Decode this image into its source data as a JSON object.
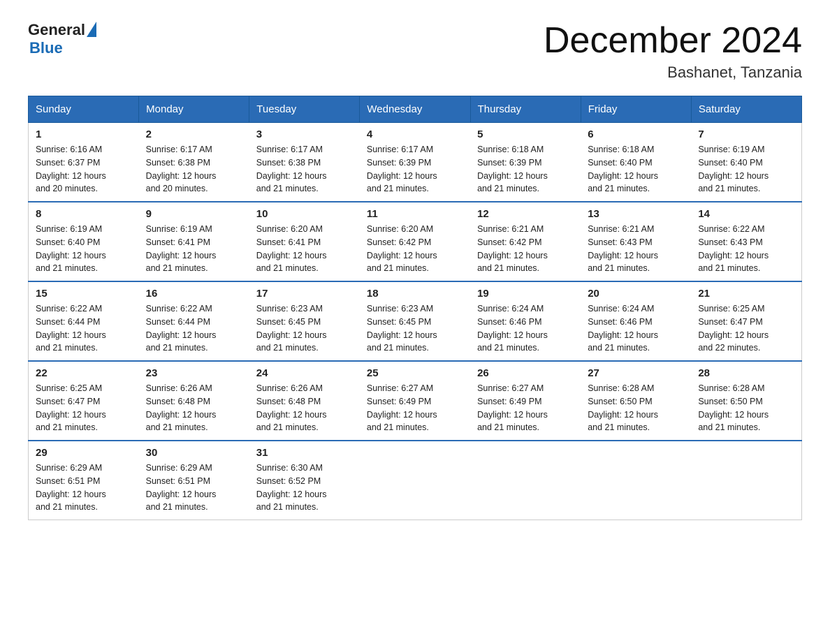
{
  "header": {
    "logo_general": "General",
    "logo_blue": "Blue",
    "month": "December 2024",
    "location": "Bashanet, Tanzania"
  },
  "weekdays": [
    "Sunday",
    "Monday",
    "Tuesday",
    "Wednesday",
    "Thursday",
    "Friday",
    "Saturday"
  ],
  "weeks": [
    [
      {
        "day": "1",
        "sunrise": "6:16 AM",
        "sunset": "6:37 PM",
        "daylight": "12 hours and 20 minutes."
      },
      {
        "day": "2",
        "sunrise": "6:17 AM",
        "sunset": "6:38 PM",
        "daylight": "12 hours and 20 minutes."
      },
      {
        "day": "3",
        "sunrise": "6:17 AM",
        "sunset": "6:38 PM",
        "daylight": "12 hours and 21 minutes."
      },
      {
        "day": "4",
        "sunrise": "6:17 AM",
        "sunset": "6:39 PM",
        "daylight": "12 hours and 21 minutes."
      },
      {
        "day": "5",
        "sunrise": "6:18 AM",
        "sunset": "6:39 PM",
        "daylight": "12 hours and 21 minutes."
      },
      {
        "day": "6",
        "sunrise": "6:18 AM",
        "sunset": "6:40 PM",
        "daylight": "12 hours and 21 minutes."
      },
      {
        "day": "7",
        "sunrise": "6:19 AM",
        "sunset": "6:40 PM",
        "daylight": "12 hours and 21 minutes."
      }
    ],
    [
      {
        "day": "8",
        "sunrise": "6:19 AM",
        "sunset": "6:40 PM",
        "daylight": "12 hours and 21 minutes."
      },
      {
        "day": "9",
        "sunrise": "6:19 AM",
        "sunset": "6:41 PM",
        "daylight": "12 hours and 21 minutes."
      },
      {
        "day": "10",
        "sunrise": "6:20 AM",
        "sunset": "6:41 PM",
        "daylight": "12 hours and 21 minutes."
      },
      {
        "day": "11",
        "sunrise": "6:20 AM",
        "sunset": "6:42 PM",
        "daylight": "12 hours and 21 minutes."
      },
      {
        "day": "12",
        "sunrise": "6:21 AM",
        "sunset": "6:42 PM",
        "daylight": "12 hours and 21 minutes."
      },
      {
        "day": "13",
        "sunrise": "6:21 AM",
        "sunset": "6:43 PM",
        "daylight": "12 hours and 21 minutes."
      },
      {
        "day": "14",
        "sunrise": "6:22 AM",
        "sunset": "6:43 PM",
        "daylight": "12 hours and 21 minutes."
      }
    ],
    [
      {
        "day": "15",
        "sunrise": "6:22 AM",
        "sunset": "6:44 PM",
        "daylight": "12 hours and 21 minutes."
      },
      {
        "day": "16",
        "sunrise": "6:22 AM",
        "sunset": "6:44 PM",
        "daylight": "12 hours and 21 minutes."
      },
      {
        "day": "17",
        "sunrise": "6:23 AM",
        "sunset": "6:45 PM",
        "daylight": "12 hours and 21 minutes."
      },
      {
        "day": "18",
        "sunrise": "6:23 AM",
        "sunset": "6:45 PM",
        "daylight": "12 hours and 21 minutes."
      },
      {
        "day": "19",
        "sunrise": "6:24 AM",
        "sunset": "6:46 PM",
        "daylight": "12 hours and 21 minutes."
      },
      {
        "day": "20",
        "sunrise": "6:24 AM",
        "sunset": "6:46 PM",
        "daylight": "12 hours and 21 minutes."
      },
      {
        "day": "21",
        "sunrise": "6:25 AM",
        "sunset": "6:47 PM",
        "daylight": "12 hours and 22 minutes."
      }
    ],
    [
      {
        "day": "22",
        "sunrise": "6:25 AM",
        "sunset": "6:47 PM",
        "daylight": "12 hours and 21 minutes."
      },
      {
        "day": "23",
        "sunrise": "6:26 AM",
        "sunset": "6:48 PM",
        "daylight": "12 hours and 21 minutes."
      },
      {
        "day": "24",
        "sunrise": "6:26 AM",
        "sunset": "6:48 PM",
        "daylight": "12 hours and 21 minutes."
      },
      {
        "day": "25",
        "sunrise": "6:27 AM",
        "sunset": "6:49 PM",
        "daylight": "12 hours and 21 minutes."
      },
      {
        "day": "26",
        "sunrise": "6:27 AM",
        "sunset": "6:49 PM",
        "daylight": "12 hours and 21 minutes."
      },
      {
        "day": "27",
        "sunrise": "6:28 AM",
        "sunset": "6:50 PM",
        "daylight": "12 hours and 21 minutes."
      },
      {
        "day": "28",
        "sunrise": "6:28 AM",
        "sunset": "6:50 PM",
        "daylight": "12 hours and 21 minutes."
      }
    ],
    [
      {
        "day": "29",
        "sunrise": "6:29 AM",
        "sunset": "6:51 PM",
        "daylight": "12 hours and 21 minutes."
      },
      {
        "day": "30",
        "sunrise": "6:29 AM",
        "sunset": "6:51 PM",
        "daylight": "12 hours and 21 minutes."
      },
      {
        "day": "31",
        "sunrise": "6:30 AM",
        "sunset": "6:52 PM",
        "daylight": "12 hours and 21 minutes."
      },
      null,
      null,
      null,
      null
    ]
  ],
  "labels": {
    "sunrise": "Sunrise:",
    "sunset": "Sunset:",
    "daylight": "Daylight:"
  }
}
